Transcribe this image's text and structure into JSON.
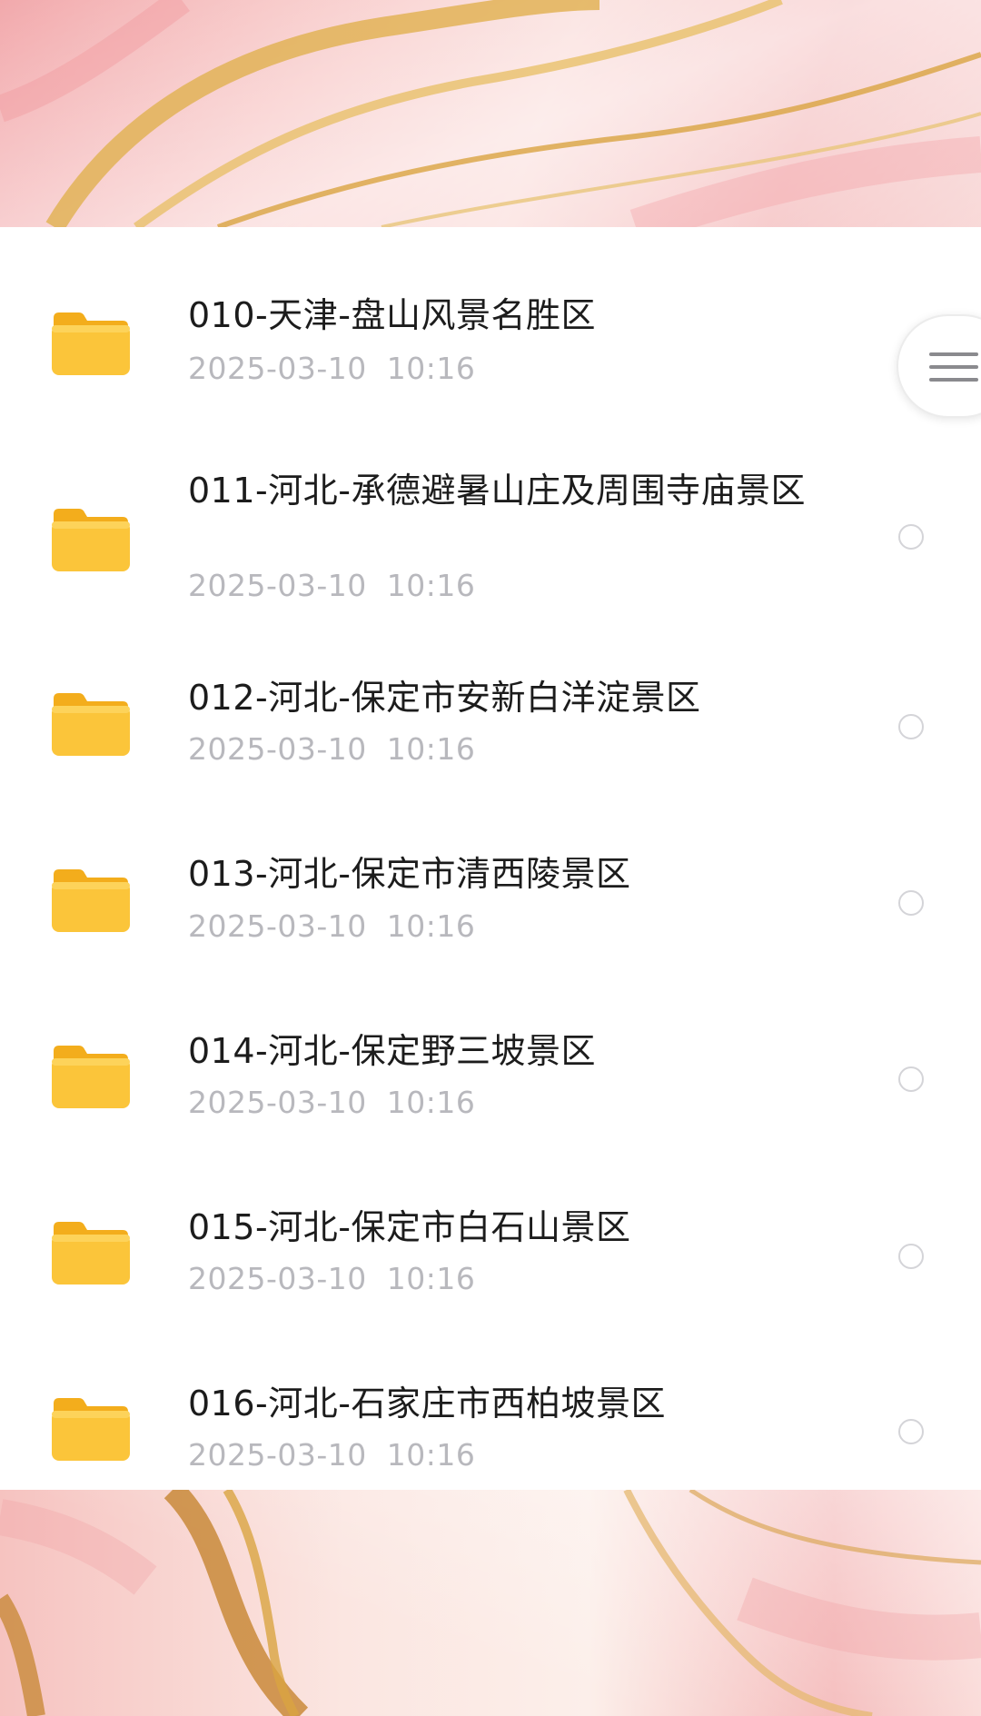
{
  "file_list": {
    "items": [
      {
        "title": "010-天津-盘山风景名胜区",
        "date": "2025-03-10  10:16",
        "icon": "folder-icon"
      },
      {
        "title": "011-河北-承德避暑山庄及周围寺庙景区",
        "date": "2025-03-10  10:16",
        "icon": "folder-icon"
      },
      {
        "title": "012-河北-保定市安新白洋淀景区",
        "date": "2025-03-10  10:16",
        "icon": "folder-icon"
      },
      {
        "title": "013-河北-保定市清西陵景区",
        "date": "2025-03-10  10:16",
        "icon": "folder-icon"
      },
      {
        "title": "014-河北-保定野三坡景区",
        "date": "2025-03-10  10:16",
        "icon": "folder-icon"
      },
      {
        "title": "015-河北-保定市白石山景区",
        "date": "2025-03-10  10:16",
        "icon": "folder-icon"
      },
      {
        "title": "016-河北-石家庄市西柏坡景区",
        "date": "2025-03-10  10:16",
        "icon": "folder-icon"
      }
    ]
  },
  "side_handle": {
    "icon": "menu-icon"
  },
  "colors": {
    "folder": "#fbc53a",
    "title_text": "#1c1c1c",
    "date_text": "#b8b8bd",
    "radio_border": "#d4d4d8",
    "marble_pink": "#f3b7b8",
    "marble_gold": "#d9a441"
  }
}
